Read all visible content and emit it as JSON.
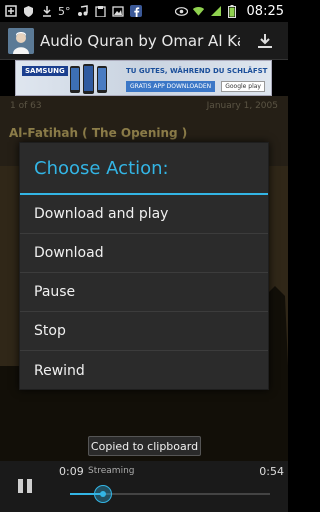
{
  "status_bar": {
    "temperature": "5°",
    "time": "08:25",
    "battery_percent": 90
  },
  "app_bar": {
    "title": "Audio Quran by Omar Al Kaz..."
  },
  "ad": {
    "brand": "SAMSUNG",
    "headline": "TU GUTES, WÄHREND DU SCHLÄFST",
    "button": "GRATIS APP DOWNLOADEN",
    "store": "Google play"
  },
  "content": {
    "index": "1 of 63",
    "date": "January 1, 2005",
    "surah": "Al-Fatihah ( The Opening )"
  },
  "dialog": {
    "title": "Choose Action:",
    "items": [
      "Download and play",
      "Download",
      "Pause",
      "Stop",
      "Rewind"
    ]
  },
  "toast": "Copied to clipboard",
  "player": {
    "elapsed": "0:09",
    "status": "Streaming",
    "total": "0:54",
    "progress": 0.167
  },
  "colors": {
    "accent": "#33b5e5",
    "surah_title": "#d8c070"
  }
}
